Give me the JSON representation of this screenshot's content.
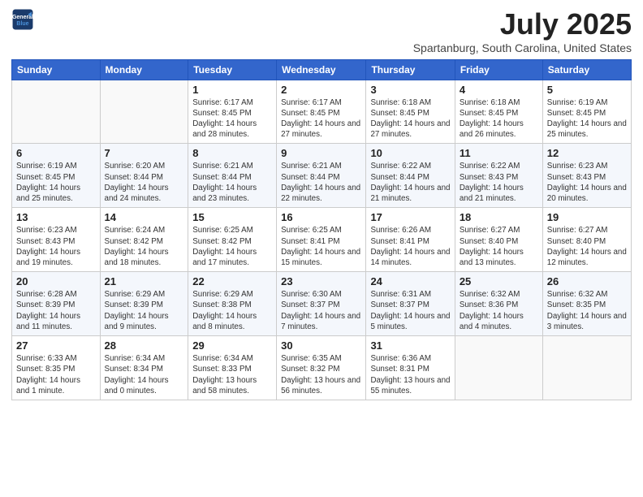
{
  "header": {
    "logo_line1": "General",
    "logo_line2": "Blue",
    "month_year": "July 2025",
    "location": "Spartanburg, South Carolina, United States"
  },
  "calendar": {
    "days_of_week": [
      "Sunday",
      "Monday",
      "Tuesday",
      "Wednesday",
      "Thursday",
      "Friday",
      "Saturday"
    ],
    "weeks": [
      [
        {
          "day": "",
          "info": ""
        },
        {
          "day": "",
          "info": ""
        },
        {
          "day": "1",
          "info": "Sunrise: 6:17 AM\nSunset: 8:45 PM\nDaylight: 14 hours and 28 minutes."
        },
        {
          "day": "2",
          "info": "Sunrise: 6:17 AM\nSunset: 8:45 PM\nDaylight: 14 hours and 27 minutes."
        },
        {
          "day": "3",
          "info": "Sunrise: 6:18 AM\nSunset: 8:45 PM\nDaylight: 14 hours and 27 minutes."
        },
        {
          "day": "4",
          "info": "Sunrise: 6:18 AM\nSunset: 8:45 PM\nDaylight: 14 hours and 26 minutes."
        },
        {
          "day": "5",
          "info": "Sunrise: 6:19 AM\nSunset: 8:45 PM\nDaylight: 14 hours and 25 minutes."
        }
      ],
      [
        {
          "day": "6",
          "info": "Sunrise: 6:19 AM\nSunset: 8:45 PM\nDaylight: 14 hours and 25 minutes."
        },
        {
          "day": "7",
          "info": "Sunrise: 6:20 AM\nSunset: 8:44 PM\nDaylight: 14 hours and 24 minutes."
        },
        {
          "day": "8",
          "info": "Sunrise: 6:21 AM\nSunset: 8:44 PM\nDaylight: 14 hours and 23 minutes."
        },
        {
          "day": "9",
          "info": "Sunrise: 6:21 AM\nSunset: 8:44 PM\nDaylight: 14 hours and 22 minutes."
        },
        {
          "day": "10",
          "info": "Sunrise: 6:22 AM\nSunset: 8:44 PM\nDaylight: 14 hours and 21 minutes."
        },
        {
          "day": "11",
          "info": "Sunrise: 6:22 AM\nSunset: 8:43 PM\nDaylight: 14 hours and 21 minutes."
        },
        {
          "day": "12",
          "info": "Sunrise: 6:23 AM\nSunset: 8:43 PM\nDaylight: 14 hours and 20 minutes."
        }
      ],
      [
        {
          "day": "13",
          "info": "Sunrise: 6:23 AM\nSunset: 8:43 PM\nDaylight: 14 hours and 19 minutes."
        },
        {
          "day": "14",
          "info": "Sunrise: 6:24 AM\nSunset: 8:42 PM\nDaylight: 14 hours and 18 minutes."
        },
        {
          "day": "15",
          "info": "Sunrise: 6:25 AM\nSunset: 8:42 PM\nDaylight: 14 hours and 17 minutes."
        },
        {
          "day": "16",
          "info": "Sunrise: 6:25 AM\nSunset: 8:41 PM\nDaylight: 14 hours and 15 minutes."
        },
        {
          "day": "17",
          "info": "Sunrise: 6:26 AM\nSunset: 8:41 PM\nDaylight: 14 hours and 14 minutes."
        },
        {
          "day": "18",
          "info": "Sunrise: 6:27 AM\nSunset: 8:40 PM\nDaylight: 14 hours and 13 minutes."
        },
        {
          "day": "19",
          "info": "Sunrise: 6:27 AM\nSunset: 8:40 PM\nDaylight: 14 hours and 12 minutes."
        }
      ],
      [
        {
          "day": "20",
          "info": "Sunrise: 6:28 AM\nSunset: 8:39 PM\nDaylight: 14 hours and 11 minutes."
        },
        {
          "day": "21",
          "info": "Sunrise: 6:29 AM\nSunset: 8:39 PM\nDaylight: 14 hours and 9 minutes."
        },
        {
          "day": "22",
          "info": "Sunrise: 6:29 AM\nSunset: 8:38 PM\nDaylight: 14 hours and 8 minutes."
        },
        {
          "day": "23",
          "info": "Sunrise: 6:30 AM\nSunset: 8:37 PM\nDaylight: 14 hours and 7 minutes."
        },
        {
          "day": "24",
          "info": "Sunrise: 6:31 AM\nSunset: 8:37 PM\nDaylight: 14 hours and 5 minutes."
        },
        {
          "day": "25",
          "info": "Sunrise: 6:32 AM\nSunset: 8:36 PM\nDaylight: 14 hours and 4 minutes."
        },
        {
          "day": "26",
          "info": "Sunrise: 6:32 AM\nSunset: 8:35 PM\nDaylight: 14 hours and 3 minutes."
        }
      ],
      [
        {
          "day": "27",
          "info": "Sunrise: 6:33 AM\nSunset: 8:35 PM\nDaylight: 14 hours and 1 minute."
        },
        {
          "day": "28",
          "info": "Sunrise: 6:34 AM\nSunset: 8:34 PM\nDaylight: 14 hours and 0 minutes."
        },
        {
          "day": "29",
          "info": "Sunrise: 6:34 AM\nSunset: 8:33 PM\nDaylight: 13 hours and 58 minutes."
        },
        {
          "day": "30",
          "info": "Sunrise: 6:35 AM\nSunset: 8:32 PM\nDaylight: 13 hours and 56 minutes."
        },
        {
          "day": "31",
          "info": "Sunrise: 6:36 AM\nSunset: 8:31 PM\nDaylight: 13 hours and 55 minutes."
        },
        {
          "day": "",
          "info": ""
        },
        {
          "day": "",
          "info": ""
        }
      ]
    ]
  }
}
